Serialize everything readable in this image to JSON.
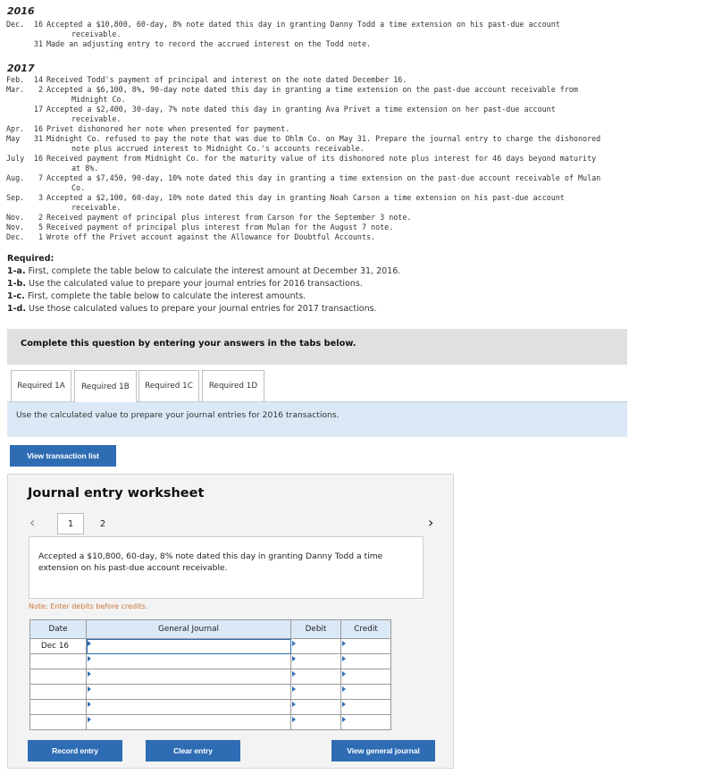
{
  "problem": {
    "year_2016": "2016",
    "entries_2016": [
      {
        "month": "Dec.",
        "day": "16",
        "lines": [
          "Accepted a $10,800, 60-day, 8% note dated this day in granting Danny Todd a time extension on his past-due account",
          "receivable."
        ]
      },
      {
        "month": "",
        "day": "31",
        "lines": [
          "Made an adjusting entry to record the accrued interest on the Todd note."
        ]
      }
    ],
    "year_2017": "2017",
    "entries_2017": [
      {
        "month": "Feb.",
        "day": "14",
        "lines": [
          "Received Todd's payment of principal and interest on the note dated December 16."
        ]
      },
      {
        "month": "Mar.",
        "day": "2",
        "lines": [
          "Accepted a $6,100, 8%, 90-day note dated this day in granting a time extension on the past-due account receivable from",
          "Midnight Co."
        ]
      },
      {
        "month": "",
        "day": "17",
        "lines": [
          "Accepted a $2,400, 30-day, 7% note dated this day in granting Ava Privet a time extension on her past-due account",
          "receivable."
        ]
      },
      {
        "month": "Apr.",
        "day": "16",
        "lines": [
          "Privet dishonored her note when presented for payment."
        ]
      },
      {
        "month": "May",
        "day": "31",
        "lines": [
          "Midnight Co. refused to pay the note that was due to Ohlm Co. on May 31. Prepare the journal entry to charge the dishonored",
          "note plus accrued interest to Midnight Co.'s accounts receivable."
        ]
      },
      {
        "month": "July",
        "day": "16",
        "lines": [
          "Received payment from Midnight Co. for the maturity value of its dishonored note plus interest for 46 days beyond maturity",
          "at 8%."
        ]
      },
      {
        "month": "Aug.",
        "day": "7",
        "lines": [
          "Accepted a $7,450, 90-day, 10% note dated this day in granting a time extension on the past-due account receivable of Mulan",
          "Co."
        ]
      },
      {
        "month": "Sep.",
        "day": "3",
        "lines": [
          "Accepted a $2,100, 60-day, 10% note dated this day in granting Noah Carson a time extension on his past-due account",
          "receivable."
        ]
      },
      {
        "month": "Nov.",
        "day": "2",
        "lines": [
          "Received payment of principal plus interest from Carson for the September 3 note."
        ]
      },
      {
        "month": "Nov.",
        "day": "5",
        "lines": [
          "Received payment of principal plus interest from Mulan for the August 7 note."
        ]
      },
      {
        "month": "Dec.",
        "day": "1",
        "lines": [
          "Wrote off the Privet account against the Allowance for Doubtful Accounts."
        ]
      }
    ]
  },
  "required": {
    "title": "Required:",
    "items": [
      {
        "label": "1-a.",
        "text": " First, complete the table below to calculate the interest amount at December 31, 2016."
      },
      {
        "label": "1-b.",
        "text": " Use the calculated value to prepare your journal entries for 2016 transactions."
      },
      {
        "label": "1-c.",
        "text": " First, complete the table below to calculate the interest amounts."
      },
      {
        "label": "1-d.",
        "text": " Use those calculated values to prepare your journal entries for 2017 transactions."
      }
    ]
  },
  "instruction_bar": "Complete this question by entering your answers in the tabs below.",
  "tabs": [
    "Required 1A",
    "Required 1B",
    "Required 1C",
    "Required 1D"
  ],
  "active_tab": "Required 1B",
  "tab_instruction": "Use the calculated value to prepare your journal entries for 2016 transactions.",
  "buttons": {
    "view_transaction_list": "View transaction list",
    "record_entry": "Record entry",
    "clear_entry": "Clear entry",
    "view_general_journal": "View general journal"
  },
  "worksheet": {
    "title": "Journal entry worksheet",
    "pages": [
      "1",
      "2"
    ],
    "current_page": "1",
    "prev_icon": "‹",
    "next_icon": "›",
    "description": "Accepted a $10,800, 60-day, 8% note dated this day in granting Danny Todd a time extension on his past-due account receivable.",
    "note": "Note: Enter debits before credits.",
    "columns": {
      "date": "Date",
      "journal": "General Journal",
      "debit": "Debit",
      "credit": "Credit"
    },
    "rows": [
      {
        "date": "Dec 16"
      },
      {
        "date": ""
      },
      {
        "date": ""
      },
      {
        "date": ""
      },
      {
        "date": ""
      },
      {
        "date": ""
      }
    ]
  },
  "colors": {
    "accent": "#2e6db4",
    "tab_content_bg": "#dbe9f7",
    "note_text": "#c9773a",
    "instruction_bar_bg": "#e0e0e0"
  }
}
